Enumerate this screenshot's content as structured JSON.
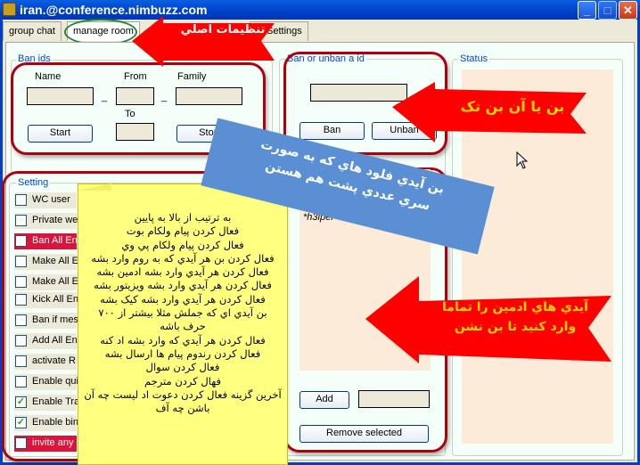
{
  "window": {
    "title": "iran.@conference.nimbuzz.com",
    "buttons": [
      "minimize",
      "maximize",
      "close"
    ]
  },
  "tabs": [
    {
      "label": "group chat"
    },
    {
      "label": "manage room",
      "selected": true
    },
    {
      "label": "Settings"
    }
  ],
  "ban_ids": {
    "legend": "Ban ids",
    "name_label": "Name",
    "from_label": "From",
    "family_label": "Family",
    "to_label": "To",
    "dash": "_",
    "start": "Start",
    "stop": "Stop",
    "name_value": "",
    "from_value": "",
    "family_value": "",
    "to_value": ""
  },
  "ban_unban": {
    "legend": "Ban or unban a id",
    "id_value": "",
    "ban": "Ban",
    "unban": "Unban",
    "admin_list": [
      "*h3lper*"
    ],
    "add": "Add",
    "add_value": "",
    "remove": "Remove selected"
  },
  "status": {
    "legend": "Status"
  },
  "setting": {
    "legend": "Setting",
    "items": [
      {
        "label": "WC user",
        "checked": false,
        "highlight": false
      },
      {
        "label": "Private we",
        "checked": false,
        "highlight": false
      },
      {
        "label": "Ban All En",
        "checked": false,
        "highlight": true
      },
      {
        "label": "Make All E",
        "checked": false,
        "highlight": false
      },
      {
        "label": "Make All E",
        "checked": false,
        "highlight": false
      },
      {
        "label": "Kick All En",
        "checked": false,
        "highlight": false
      },
      {
        "label": "Ban if mes",
        "checked": false,
        "highlight": false
      },
      {
        "label": "Add All En",
        "checked": false,
        "highlight": false
      },
      {
        "label": " activate R",
        "checked": false,
        "highlight": false
      },
      {
        "label": "Enable qui",
        "checked": false,
        "highlight": false
      },
      {
        "label": "Enable Tra",
        "checked": true,
        "highlight": false
      },
      {
        "label": "Enable bin",
        "checked": true,
        "highlight": false
      },
      {
        "label": "invite any",
        "checked": false,
        "highlight": true
      }
    ]
  },
  "annotations": {
    "tab_arrow": "تنظیمات اصلي",
    "ban_arrow": "بن یا آن بن تک",
    "admin_arrow": [
      "آیدي هاي ادمین را تماما",
      "وارد کنید تا بن نشن"
    ],
    "banner": [
      "بن آیدي فلود هاي که به صورت",
      "سري عددي پشت هم هستن"
    ],
    "note": [
      "به ترتیب از بالا به پایین",
      "فعال کردن پیام ولکام بوت",
      "فعال کردن پیام ولکام پي وي",
      "فعال کردن بن هر آیدي که به روم وارد بشه",
      "فعال کردن هر آیدي وارد بشه ادمین بشه",
      "فعال کردن هر آیدي وارد بشه ویزیتور بشه",
      "فعال کردن هر آیدي وارد بشه کیک بشه",
      "بن آیدي اي که جملش مثلا بیشتر از ۷۰۰",
      "حرف باشه",
      "فعال کردن هر آیدي که وارد بشه اد کنه",
      "فعال کردن رندوم پیام ها ارسال بشه",
      "فعال کردن سوال",
      "فهال کردن مترجم",
      "آخرین گزینه فعال کردن دعوت اد لیست چه آن",
      "باشن چه آف"
    ]
  },
  "colors": {
    "arrow": "#ff0000",
    "arrow_text": "#ffd700",
    "banner": "#5a8fd4",
    "note": "#ffff80",
    "highlight": "#dc143c",
    "panel": "#f5fffa",
    "list": "#fbebd8"
  }
}
